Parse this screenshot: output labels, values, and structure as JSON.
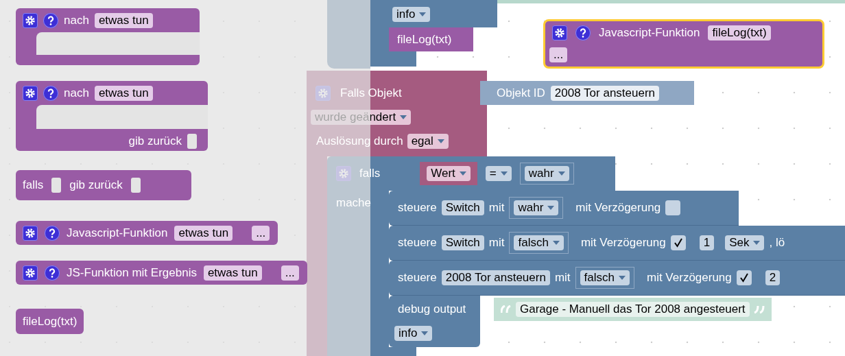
{
  "flyout": {
    "blocks": [
      {
        "kind": "procedure",
        "label": "nach",
        "name": "etwas tun"
      },
      {
        "kind": "procedure_return",
        "label": "nach",
        "name": "etwas tun",
        "return_label": "gib zurück"
      },
      {
        "kind": "if_return",
        "label": "falls",
        "return_label": "gib zurück"
      },
      {
        "kind": "js_function",
        "label": "Javascript-Funktion",
        "name": "etwas tun",
        "args": "..."
      },
      {
        "kind": "js_function",
        "label": "JS-Funktion mit Ergebnis",
        "name": "etwas tun",
        "args": "..."
      },
      {
        "kind": "call",
        "label": "fileLog(txt)"
      }
    ]
  },
  "workspace": {
    "log_fragment": {
      "level": "info",
      "call": "fileLog(txt)"
    },
    "js_function": {
      "label": "Javascript-Funktion",
      "name": "fileLog(txt)",
      "args": "...",
      "selected": true
    },
    "trigger": {
      "label": "Falls Objekt",
      "object_label": "Objekt ID",
      "object": "2008 Tor ansteuern",
      "event": "wurde geändert",
      "source_label": "Auslösung durch",
      "source": "egal"
    },
    "if_block": {
      "label": "falls",
      "do_label": "mache",
      "left": "Wert",
      "operator": "=",
      "right": "wahr"
    },
    "statements": [
      {
        "kind": "control",
        "label": "steuere",
        "target": "Switch",
        "with": "mit",
        "value": "wahr",
        "delay_label": "mit Verzögerung",
        "delay": false
      },
      {
        "kind": "control",
        "label": "steuere",
        "target": "Switch",
        "with": "mit",
        "value": "falsch",
        "delay_label": "mit Verzögerung",
        "delay": true,
        "delay_value": "1",
        "unit": "Sek",
        "rest": ", lö"
      },
      {
        "kind": "control",
        "label": "steuere",
        "target": "2008 Tor ansteuern",
        "with": "mit",
        "value": "falsch",
        "delay_label": "mit Verzögerung",
        "delay": true,
        "delay_value": "2"
      },
      {
        "kind": "debug",
        "label": "debug output",
        "text": "Garage - Manuell das Tor 2008 angesteuert",
        "level": "info"
      }
    ]
  }
}
